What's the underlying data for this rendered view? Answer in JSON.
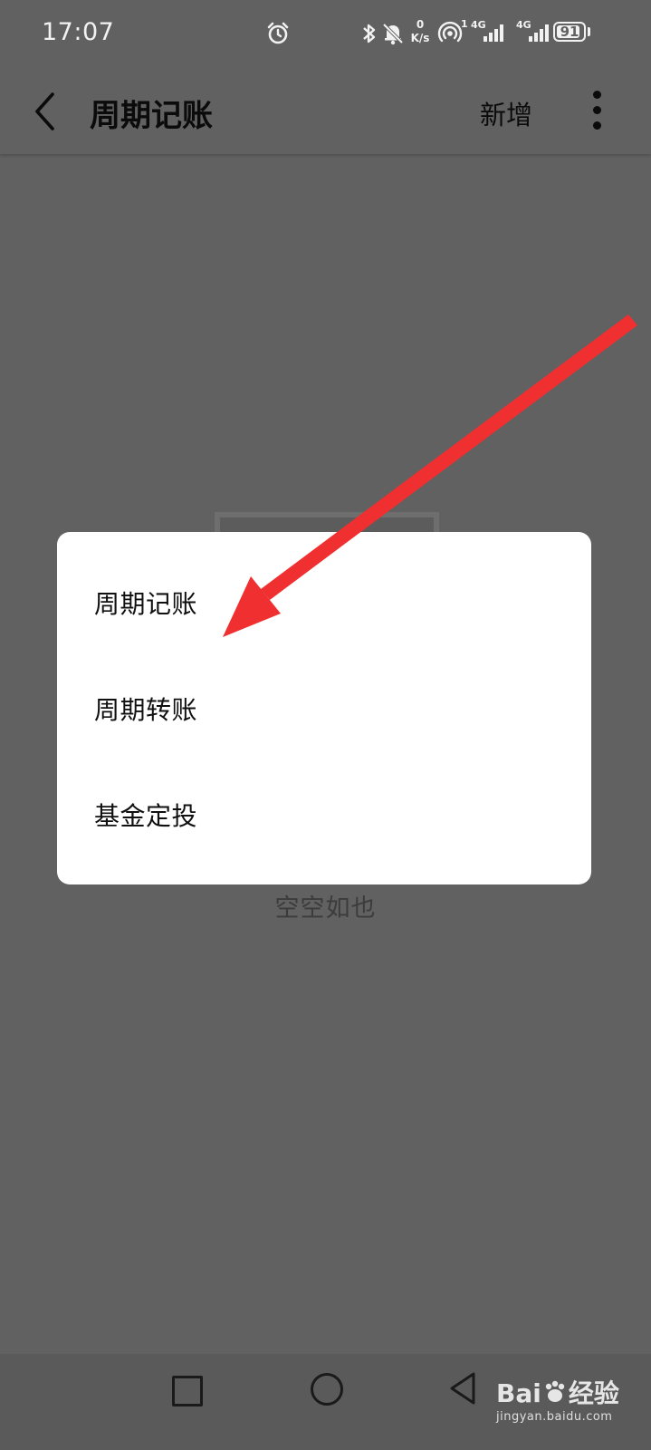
{
  "status_bar": {
    "time": "17:07",
    "net_speed_value": "0",
    "net_speed_unit": "K/s",
    "hotspot_count": "1",
    "sim1_label": "4G",
    "sim2_label": "4G",
    "battery_level": "91",
    "battery_fraction": 0.91
  },
  "app_bar": {
    "title": "周期记账",
    "add_label": "新增"
  },
  "empty_state": {
    "text": "空空如也"
  },
  "dialog": {
    "items": [
      {
        "label": "周期记账"
      },
      {
        "label": "周期转账"
      },
      {
        "label": "基金定投"
      }
    ]
  },
  "annotation": {
    "arrow_color": "#f03030"
  },
  "watermark": {
    "brand": "Bai",
    "brand_suffix": "经验",
    "url": "jingyan.baidu.com"
  }
}
